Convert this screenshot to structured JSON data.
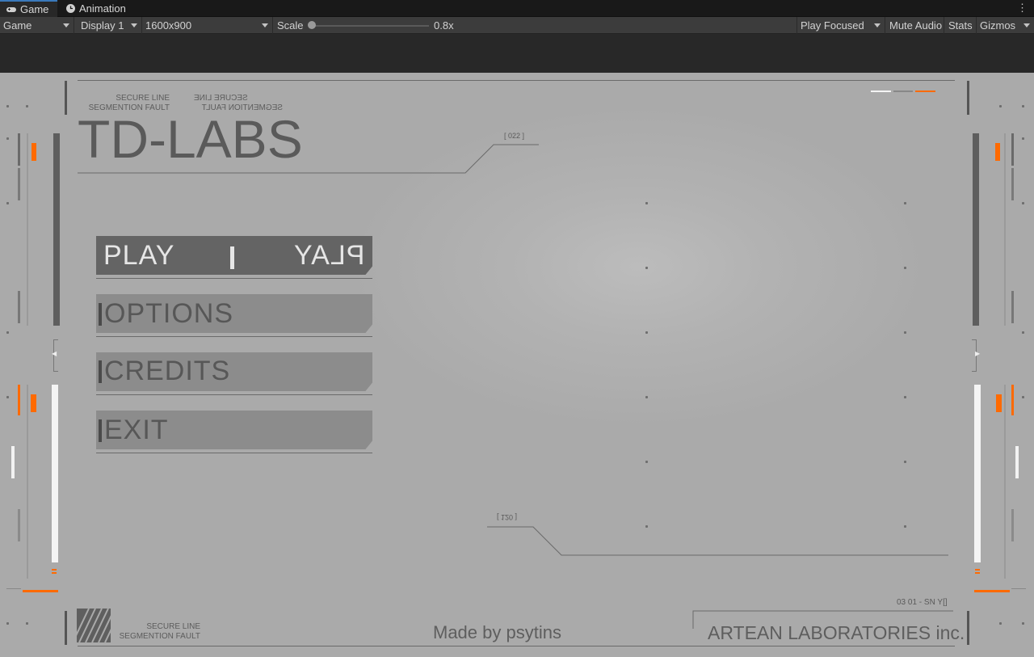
{
  "editor": {
    "tabs": [
      {
        "label": "Game",
        "icon": "gamepad-icon",
        "active": true
      },
      {
        "label": "Animation",
        "icon": "clock-icon",
        "active": false
      }
    ],
    "toolbar": {
      "view_mode": "Game",
      "display": "Display 1",
      "resolution": "1600x900",
      "scale_label": "Scale",
      "scale_value": "0.8x",
      "play_mode": "Play Focused",
      "mute_audio": "Mute Audio",
      "stats": "Stats",
      "gizmos": "Gizmos"
    }
  },
  "game": {
    "header": {
      "secure_line": "SECURE LINE",
      "segfault": "SEGMENTION FAULT",
      "secure_line_mirrored": "SECURE LINE",
      "segfault_mirrored": "SEGMENTION FAULT",
      "title": "TD-LABS"
    },
    "tags": {
      "top": "[ 022 ]",
      "bottom": "[ 120 ]"
    },
    "menu": {
      "play": "PLAY",
      "play_mirrored": "PLAY",
      "options": "OPTIONS",
      "credits": "CREDITS",
      "exit": "EXIT"
    },
    "footer": {
      "secure_line": "SECURE LINE",
      "segfault": "SEGMENTION FAULT",
      "made_by": "Made by psytins",
      "company": "ARTEAN LABORATORIES inc.",
      "code": "03 01 - SN Y[]"
    },
    "colors": {
      "accent": "#ff6a00",
      "panel": "#aaaaaa",
      "button": "#8c8c8c",
      "button_active": "#646464"
    }
  }
}
